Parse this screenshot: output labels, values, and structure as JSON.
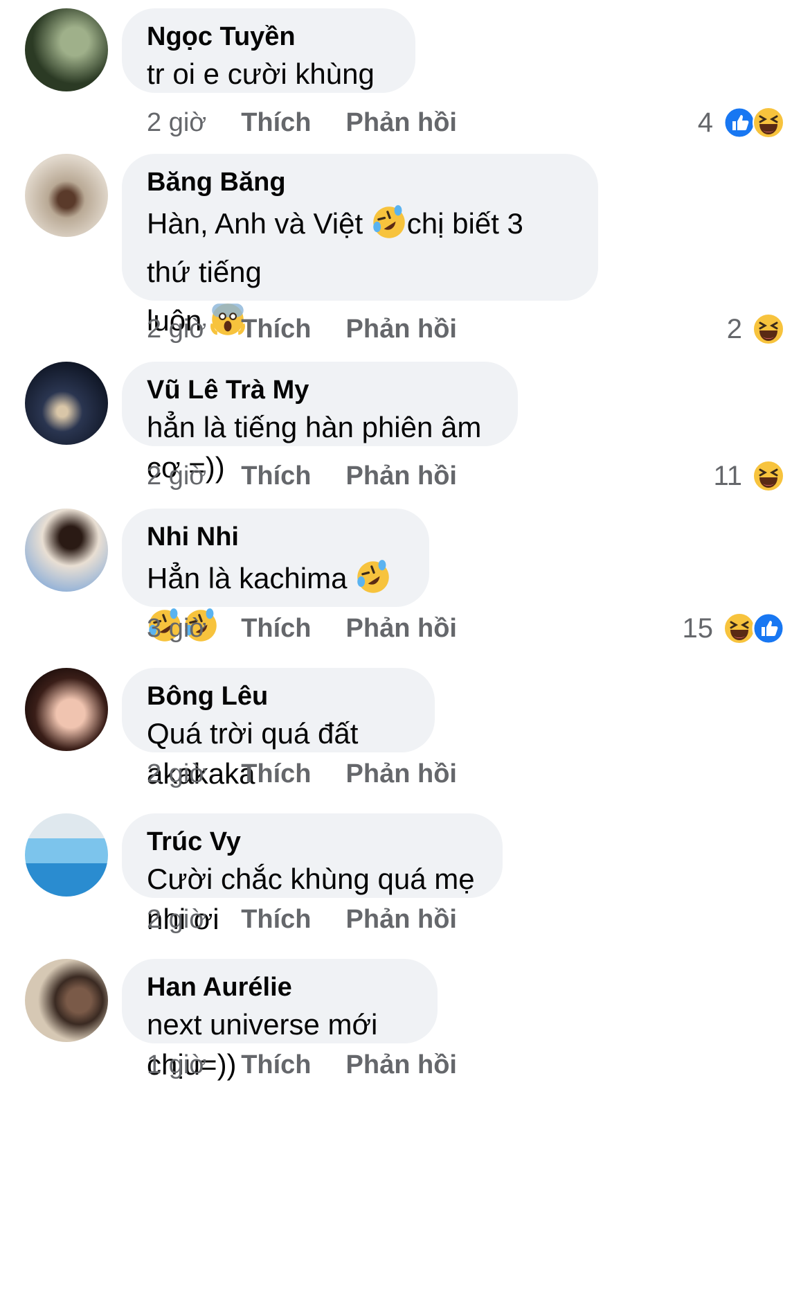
{
  "labels": {
    "like": "Thích",
    "reply": "Phản hồi"
  },
  "comments": [
    {
      "name": "Ngọc Tuyền",
      "text": "tr oi e cười khùng",
      "time": "2 giờ",
      "count": "4",
      "reactions": [
        "like-icon",
        "haha-icon"
      ],
      "avatar_colors": [
        "#1c2a1a",
        "#6b7b5c"
      ]
    },
    {
      "name": "Băng Băng",
      "text_a": "Hàn, Anh và Việt ",
      "text_b": "chị biết 3 thứ tiếng",
      "text_c": "luôn ",
      "time": "2 giờ",
      "count": "2",
      "reactions": [
        "haha-icon"
      ],
      "avatar_colors": [
        "#a59482",
        "#d8cfc2"
      ]
    },
    {
      "name": "Vũ Lê Trà My",
      "text": "hẳn là tiếng hàn phiên âm cơ =))",
      "time": "2 giờ",
      "count": "11",
      "reactions": [
        "haha-icon"
      ],
      "avatar_colors": [
        "#10182a",
        "#4a5568"
      ]
    },
    {
      "name": "Nhi Nhi",
      "text": "Hẳn là kachima ",
      "time": "3 giờ",
      "count": "15",
      "reactions": [
        "haha-icon",
        "like-icon"
      ],
      "avatar_colors": [
        "#e4d8cc",
        "#6a8fbf"
      ]
    },
    {
      "name": "Bông Lêu",
      "text": "Quá trời quá đất akakaka",
      "time": "2 giờ",
      "avatar_colors": [
        "#3a1f1a",
        "#e8b9a4"
      ]
    },
    {
      "name": "Trúc Vy",
      "text": "Cười chắc khùng quá mẹ nhi ơi",
      "time": "2 giờ",
      "avatar_colors": [
        "#3aa0d8",
        "#e9eef2"
      ]
    },
    {
      "name": "Han Aurélie",
      "text": "next universe mới chịu=))",
      "time": "1 giờ",
      "avatar_colors": [
        "#c9b9a4",
        "#3a2a22"
      ]
    }
  ]
}
